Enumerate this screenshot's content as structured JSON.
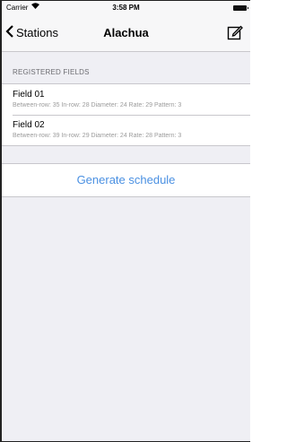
{
  "status_bar": {
    "carrier": "Carrier",
    "time": "3:58 PM"
  },
  "nav": {
    "back_label": "Stations",
    "title": "Alachua",
    "edit_icon": "compose-icon"
  },
  "section_header": "REGISTERED FIELDS",
  "fields": [
    {
      "name": "Field 01",
      "details": "Between-row: 35 In-row: 28 Diameter: 24 Rate: 29 Pattern: 3"
    },
    {
      "name": "Field 02",
      "details": "Between-row: 39 In-row: 29 Diameter: 24 Rate: 28 Pattern: 3"
    }
  ],
  "generate_label": "Generate schedule",
  "colors": {
    "accent": "#4a90e2",
    "background": "#efeff4",
    "secondary_text": "#9b9b9b"
  }
}
